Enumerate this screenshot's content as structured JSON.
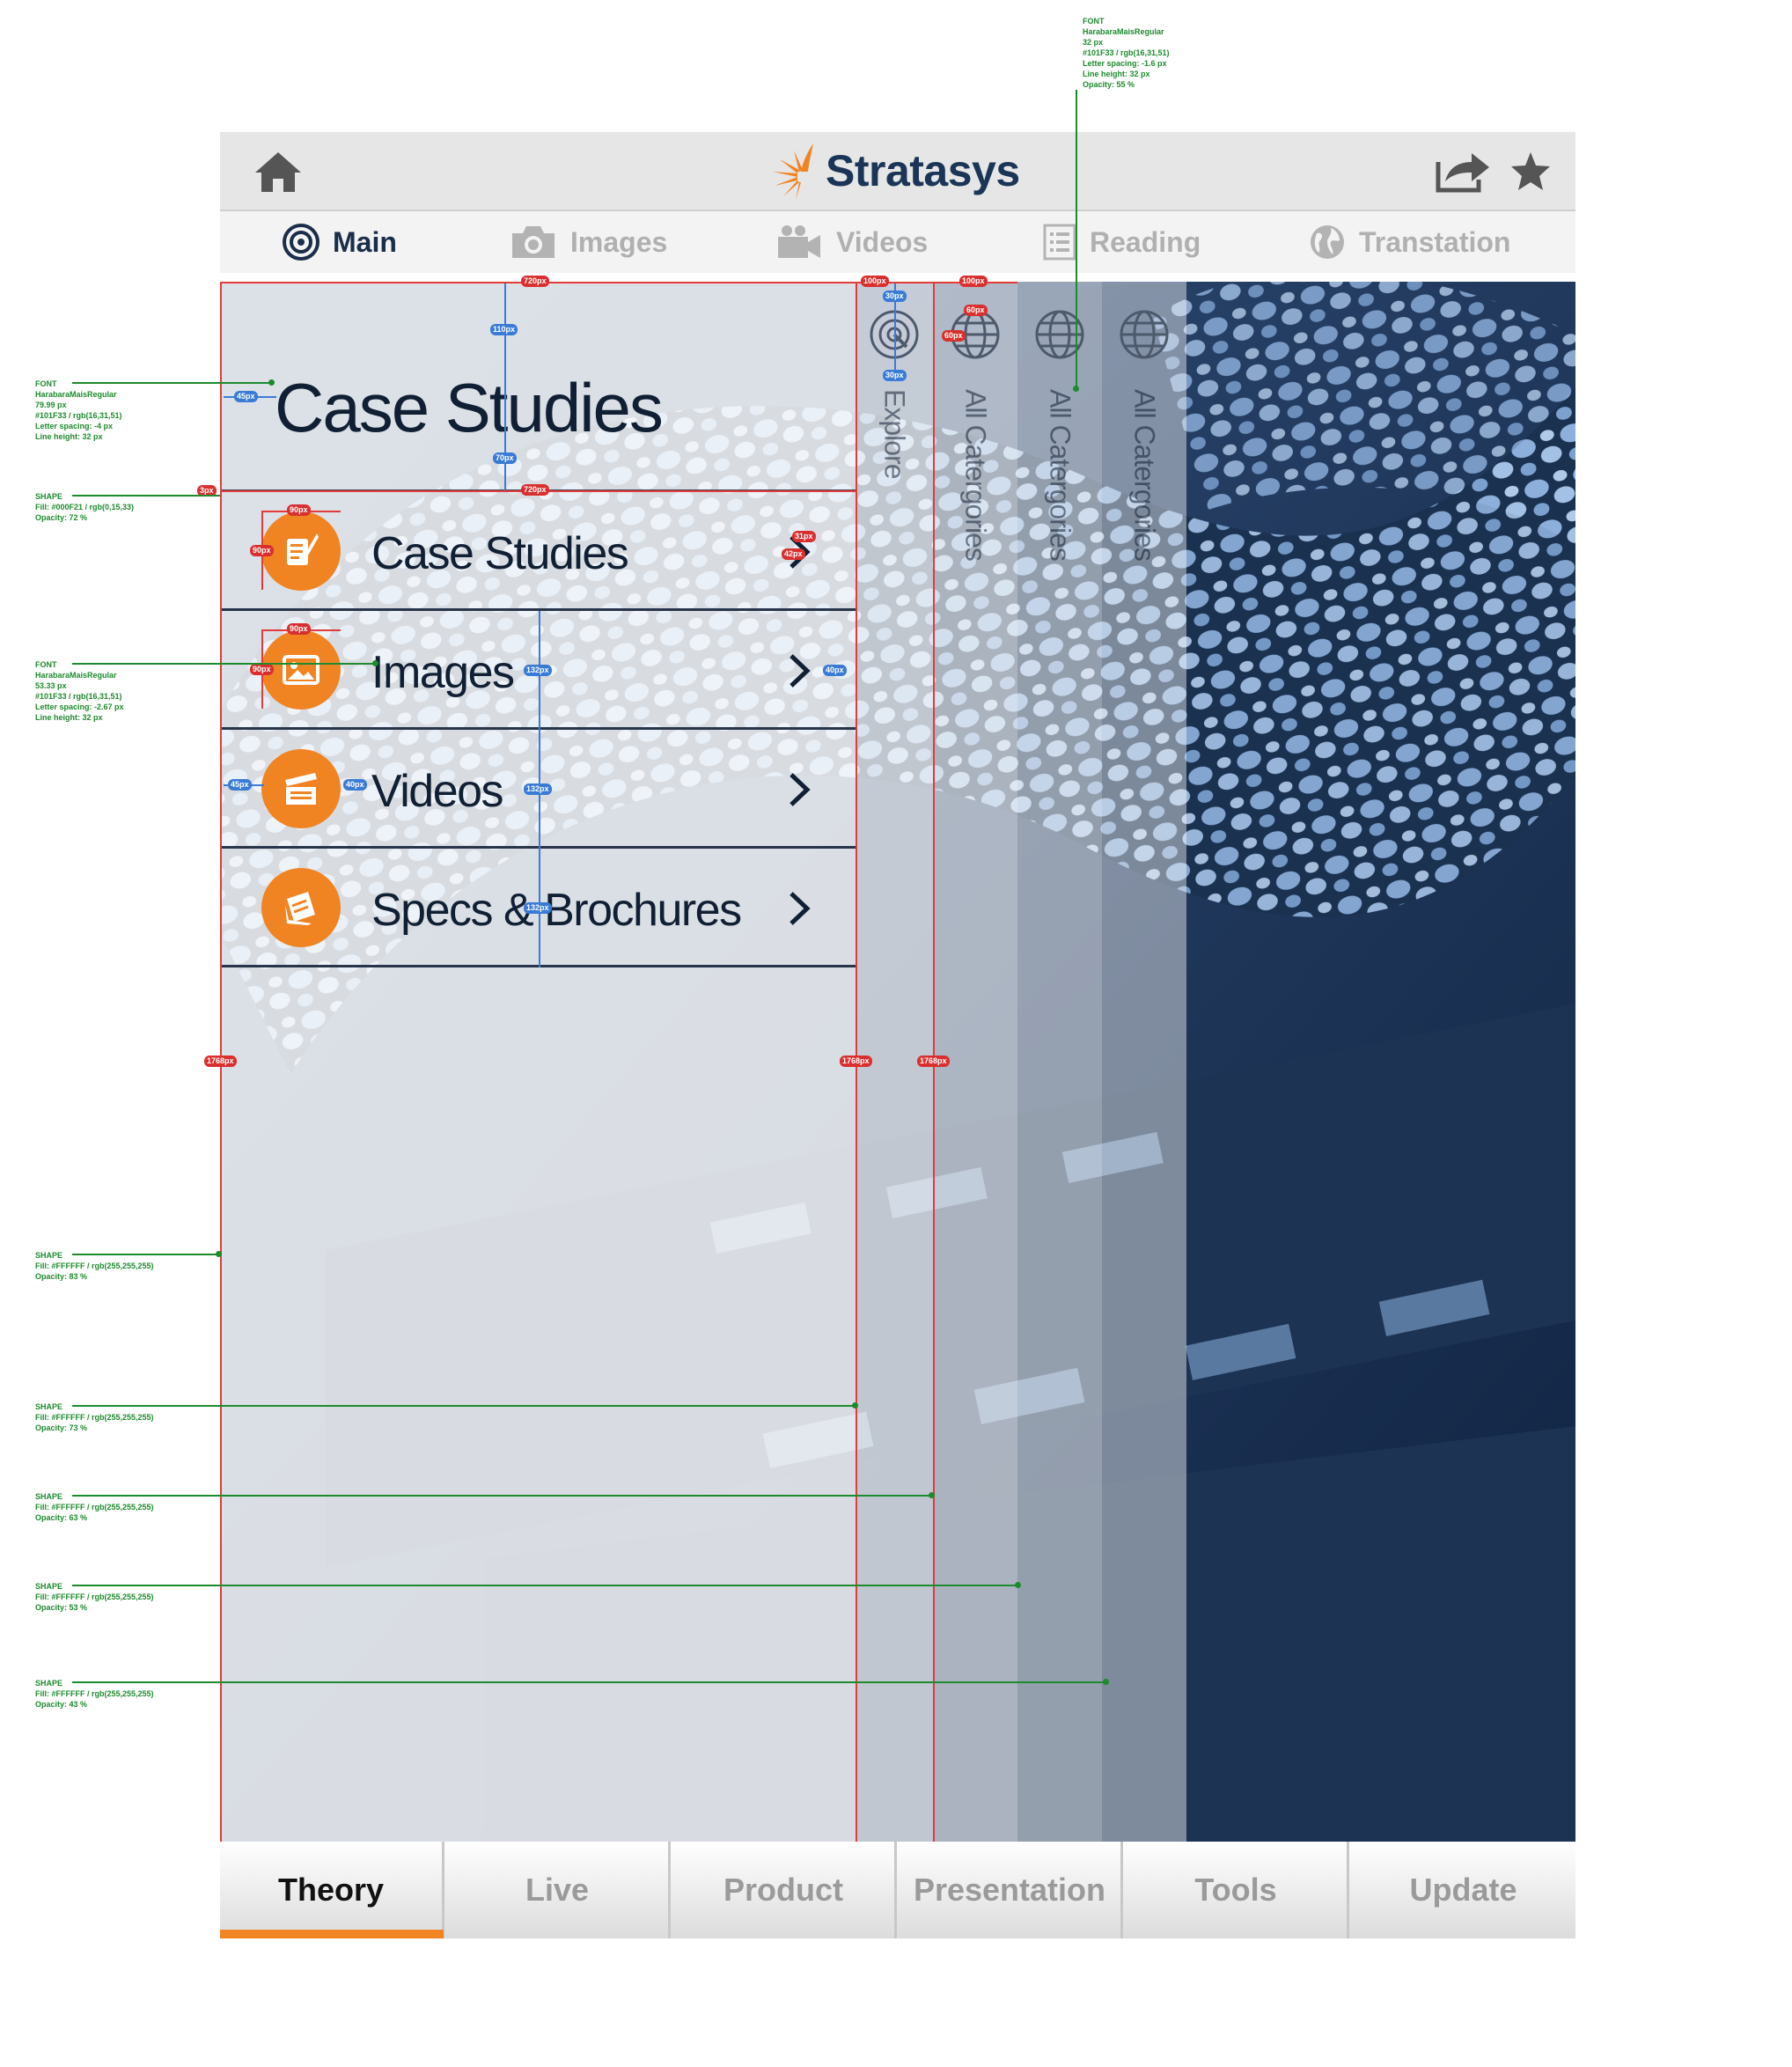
{
  "header": {
    "logo_text": "Stratasys",
    "brand_color": "#1a3557",
    "accent_color": "#f08423",
    "icons": [
      "home-icon",
      "share-icon",
      "star-icon"
    ]
  },
  "tabs": [
    {
      "label": "Main",
      "icon": "target-icon",
      "active": true
    },
    {
      "label": "Images",
      "icon": "camera-icon",
      "active": false
    },
    {
      "label": "Videos",
      "icon": "video-camera-icon",
      "active": false
    },
    {
      "label": "Reading",
      "icon": "list-icon",
      "active": false
    },
    {
      "label": "Transtation",
      "icon": "globe-icon",
      "active": false
    }
  ],
  "panel": {
    "title": "Case Studies",
    "items": [
      {
        "label": "Case Studies",
        "icon": "scroll-quill-icon"
      },
      {
        "label": "Images",
        "icon": "picture-icon"
      },
      {
        "label": "Videos",
        "icon": "clapperboard-icon"
      },
      {
        "label": "Specs & Brochures",
        "icon": "brochure-icon"
      }
    ]
  },
  "columns": [
    {
      "label": "Explore",
      "icon": "explore-icon"
    },
    {
      "label": "All Catergories",
      "icon": "globe-icon"
    },
    {
      "label": "All Catergories",
      "icon": "globe-icon"
    },
    {
      "label": "All Catergories",
      "icon": "globe-icon"
    }
  ],
  "bottom_tabs": [
    {
      "label": "Theory",
      "active": true
    },
    {
      "label": "Live",
      "active": false
    },
    {
      "label": "Product",
      "active": false
    },
    {
      "label": "Presentation",
      "active": false
    },
    {
      "label": "Tools",
      "active": false
    },
    {
      "label": "Update",
      "active": false
    }
  ],
  "annotations": {
    "font_col": [
      "FONT",
      "HarabaraMaisRegular",
      "32 px",
      "#101F33 / rgb(16,31,51)",
      "Letter spacing: -1.6 px",
      "Line height: 32 px",
      "Opacity: 55 %"
    ],
    "font_title": [
      "FONT",
      "HarabaraMaisRegular",
      "79.99 px",
      "#101F33 / rgb(16,31,51)",
      "Letter spacing: -4 px",
      "Line height: 32 px"
    ],
    "shape_line": [
      "SHAPE",
      "Fill: #000F21 / rgb(0,15,33)",
      "Opacity: 72 %"
    ],
    "font_item": [
      "FONT",
      "HarabaraMaisRegular",
      "53.33 px",
      "#101F33 / rgb(16,31,51)",
      "Letter spacing: -2.67 px",
      "Line height: 32 px"
    ],
    "shape_83": [
      "SHAPE",
      "Fill: #FFFFFF / rgb(255,255,255)",
      "Opacity: 83 %"
    ],
    "shape_73": [
      "SHAPE",
      "Fill: #FFFFFF / rgb(255,255,255)",
      "Opacity: 73 %"
    ],
    "shape_63": [
      "SHAPE",
      "Fill: #FFFFFF / rgb(255,255,255)",
      "Opacity: 63 %"
    ],
    "shape_53": [
      "SHAPE",
      "Fill: #FFFFFF / rgb(255,255,255)",
      "Opacity: 53 %"
    ],
    "shape_43": [
      "SHAPE",
      "Fill: #FFFFFF / rgb(255,255,255)",
      "Opacity: 43 %"
    ],
    "measure_720": "720px",
    "measure_110": "110px",
    "measure_45": "45px",
    "measure_70": "70px",
    "measure_3": "3px",
    "measure_90": "90px",
    "measure_31": "31px",
    "measure_42": "42px",
    "measure_132": "132px",
    "measure_40": "40px",
    "measure_100": "100px",
    "measure_30": "30px",
    "measure_60": "60px",
    "measure_1768": "1768px"
  }
}
